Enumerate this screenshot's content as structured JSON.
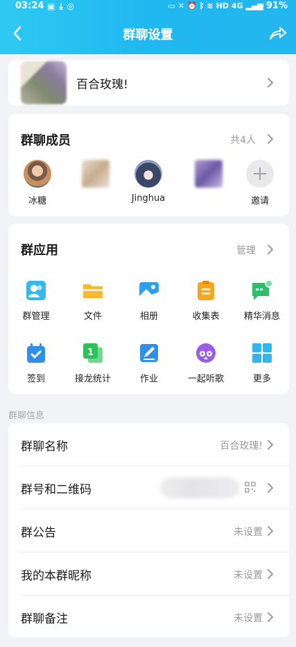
{
  "status_bar": {
    "time": "03:24",
    "left_icons": [
      "image-icon",
      "download-icon",
      "target-icon"
    ],
    "right_icons": [
      "card-icon",
      "x-icon",
      "alarm-icon",
      "bluetooth-icon",
      "wifi-icon",
      "signal-icon"
    ],
    "network": "HD 4G",
    "battery": "91%"
  },
  "header": {
    "title": "群聊设置",
    "background": "#20b8f0"
  },
  "group": {
    "name": "百合玫瑰!"
  },
  "members": {
    "title": "群聊成员",
    "count": "共4人",
    "items": [
      {
        "label": "冰糖"
      },
      {
        "label": ""
      },
      {
        "label": "Jinghua"
      },
      {
        "label": ""
      }
    ],
    "invite_label": "邀请"
  },
  "apps": {
    "title": "群应用",
    "manage_label": "管理",
    "items": [
      {
        "label": "群管理",
        "icon": "group-manage-icon",
        "color": "#36b8ef"
      },
      {
        "label": "文件",
        "icon": "folder-icon",
        "color": "#f6b92f"
      },
      {
        "label": "相册",
        "icon": "album-icon",
        "color": "#2d9ef0"
      },
      {
        "label": "收集表",
        "icon": "clipboard-icon",
        "color": "#f5a623"
      },
      {
        "label": "精华消息",
        "icon": "highlight-message-icon",
        "color": "#2bbf6a"
      },
      {
        "label": "签到",
        "icon": "checkin-icon",
        "color": "#2f8fe9"
      },
      {
        "label": "接龙统计",
        "icon": "relay-count-icon",
        "color": "#2fbf5c"
      },
      {
        "label": "作业",
        "icon": "homework-icon",
        "color": "#2f8fe9"
      },
      {
        "label": "一起听歌",
        "icon": "listen-together-icon",
        "color": "#9b5de5"
      },
      {
        "label": "更多",
        "icon": "more-grid-icon",
        "color": "#33b5ee"
      }
    ]
  },
  "info": {
    "section_label": "群聊信息",
    "rows": [
      {
        "label": "群聊名称",
        "value": "百合玫瑰!"
      },
      {
        "label": "群号和二维码",
        "value": ""
      },
      {
        "label": "群公告",
        "value": "未设置"
      },
      {
        "label": "我的本群昵称",
        "value": "未设置"
      },
      {
        "label": "群聊备注",
        "value": "未设置"
      }
    ]
  }
}
